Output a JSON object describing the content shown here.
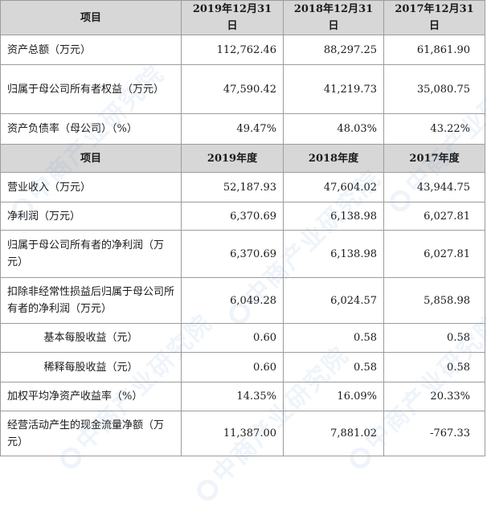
{
  "header_top": {
    "item": "项目",
    "col1": "2019年12月31日",
    "col2": "2018年12月31日",
    "col3": "2017年12月31日"
  },
  "balance_rows": [
    {
      "label": "资产总额（万元）",
      "v2019": "112,762.46",
      "v2018": "88,297.25",
      "v2017": "61,861.90"
    },
    {
      "label": "归属于母公司所有者权益（万元）",
      "v2019": "47,590.42",
      "v2018": "41,219.73",
      "v2017": "35,080.75"
    },
    {
      "label": "资产负债率（母公司）（%）",
      "v2019": "49.47%",
      "v2018": "48.03%",
      "v2017": "43.22%"
    }
  ],
  "header_mid": {
    "item": "项目",
    "col1": "2019年度",
    "col2": "2018年度",
    "col3": "2017年度"
  },
  "income_rows": [
    {
      "label": "营业收入（万元）",
      "v2019": "52,187.93",
      "v2018": "47,604.02",
      "v2017": "43,944.75"
    },
    {
      "label": "净利润（万元）",
      "v2019": "6,370.69",
      "v2018": "6,138.98",
      "v2017": "6,027.81"
    },
    {
      "label": "归属于母公司所有者的净利润（万元）",
      "v2019": "6,370.69",
      "v2018": "6,138.98",
      "v2017": "6,027.81"
    },
    {
      "label": "扣除非经常性损益后归属于母公司所有者的净利润（万元）",
      "v2019": "6,049.28",
      "v2018": "6,024.57",
      "v2017": "5,858.98"
    },
    {
      "label": "基本每股收益（元）",
      "v2019": "0.60",
      "v2018": "0.58",
      "v2017": "0.58"
    },
    {
      "label": "稀释每股收益（元）",
      "v2019": "0.60",
      "v2018": "0.58",
      "v2017": "0.58"
    },
    {
      "label": "加权平均净资产收益率（%）",
      "v2019": "14.35%",
      "v2018": "16.09%",
      "v2017": "20.33%"
    },
    {
      "label": "经营活动产生的现金流量净额（万元）",
      "v2019": "11,387.00",
      "v2018": "7,881.02",
      "v2017": "-767.33"
    }
  ],
  "watermark_text": "中商产业研究院"
}
